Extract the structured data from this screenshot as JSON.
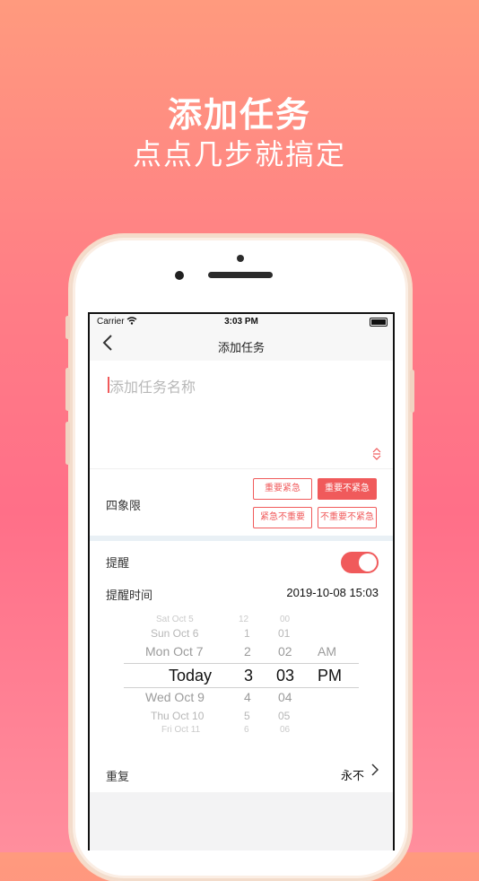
{
  "headline": {
    "title": "添加任务",
    "subtitle": "点点几步就搞定"
  },
  "status_bar": {
    "carrier": "Carrier",
    "time": "3:03 PM"
  },
  "nav": {
    "back_icon": "chevron-left-icon",
    "title": "添加任务"
  },
  "task_input": {
    "placeholder": "添加任务名称"
  },
  "quadrant": {
    "label": "四象限",
    "options": [
      "重要紧急",
      "重要不紧急",
      "紧急不重要",
      "不重要不紧急"
    ],
    "selected": "重要不紧急"
  },
  "reminder": {
    "label": "提醒",
    "enabled": true
  },
  "reminder_time": {
    "label": "提醒时间",
    "value": "2019-10-08 15:03"
  },
  "picker": {
    "dates": [
      "Sat Oct 5",
      "Sun Oct 6",
      "Mon Oct 7",
      "Today",
      "Wed Oct 9",
      "Thu Oct 10",
      "Fri Oct 11"
    ],
    "hours": [
      "12",
      "1",
      "2",
      "3",
      "4",
      "5",
      "6"
    ],
    "minutes": [
      "00",
      "01",
      "02",
      "03",
      "04",
      "05",
      "06"
    ],
    "ampm": [
      "AM",
      "PM"
    ]
  },
  "repeat": {
    "label": "重复",
    "value": "永不"
  },
  "colors": {
    "accent": "#f05a5b"
  }
}
